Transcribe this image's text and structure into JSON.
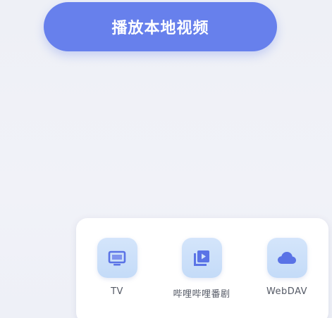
{
  "play_button": {
    "label": "播放本地视频"
  },
  "sources": {
    "items": [
      {
        "label": "TV",
        "icon": "tv-icon"
      },
      {
        "label": "哔哩哔哩番剧",
        "icon": "video-library-icon"
      },
      {
        "label": "WebDAV",
        "icon": "cloud-icon"
      }
    ]
  },
  "colors": {
    "accent": "#6780ec",
    "icon_tile": "#cfe2fa",
    "icon_glyph": "#5a73e6",
    "panel": "#ffffff"
  }
}
